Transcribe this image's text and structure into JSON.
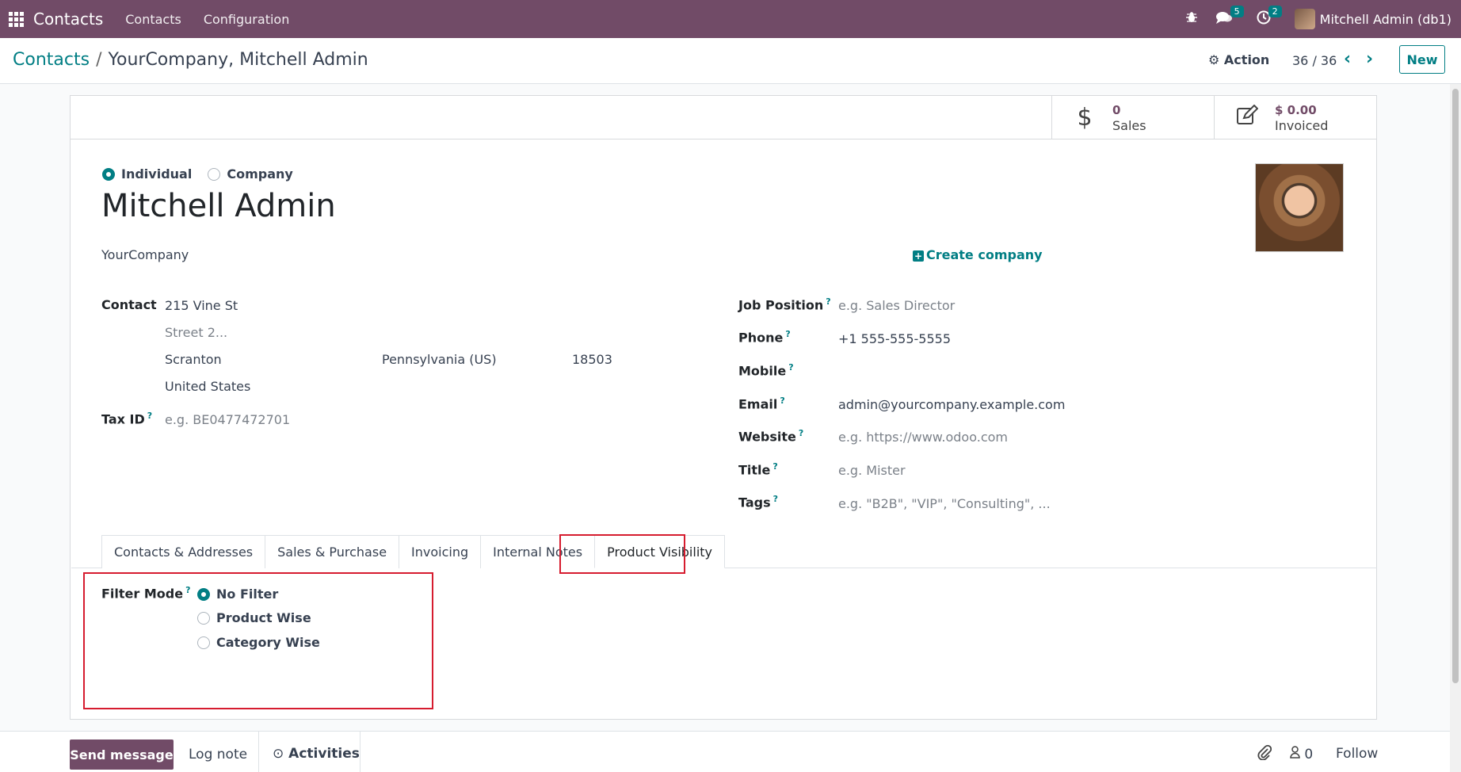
{
  "navbar": {
    "app_name": "Contacts",
    "menu": [
      "Contacts",
      "Configuration"
    ],
    "messages_badge": "5",
    "activities_badge": "2",
    "user": "Mitchell Admin (db1)",
    "icons": [
      "apps-grid-icon",
      "bug-icon",
      "chat-icon",
      "clock-icon",
      "avatar"
    ]
  },
  "breadcrumb": {
    "parent": "Contacts",
    "separator": "/",
    "current": "YourCompany, Mitchell Admin"
  },
  "controlpanel": {
    "action_label": "Action",
    "pager": "36 / 36",
    "new_label": "New"
  },
  "stat_buttons": [
    {
      "value": "0",
      "label": "Sales",
      "icon": "dollar-icon"
    },
    {
      "value": "$ 0.00",
      "label": "Invoiced",
      "icon": "edit-icon"
    }
  ],
  "partner": {
    "type_options": [
      "Individual",
      "Company"
    ],
    "selected_type": "Individual",
    "name": "Mitchell Admin",
    "company": "YourCompany",
    "create_company_label": "Create company"
  },
  "left_fields": {
    "contact_label": "Contact",
    "street": "215 Vine St",
    "street2_placeholder": "Street 2...",
    "city": "Scranton",
    "state": "Pennsylvania (US)",
    "zip": "18503",
    "country": "United States",
    "tax_label": "Tax ID",
    "tax_placeholder": "e.g. BE0477472701",
    "help_mark": "?"
  },
  "right_fields": [
    {
      "label": "Job Position",
      "value": "",
      "placeholder": "e.g. Sales Director"
    },
    {
      "label": "Phone",
      "value": "+1 555-555-5555",
      "placeholder": ""
    },
    {
      "label": "Mobile",
      "value": "",
      "placeholder": ""
    },
    {
      "label": "Email",
      "value": "admin@yourcompany.example.com",
      "placeholder": ""
    },
    {
      "label": "Website",
      "value": "",
      "placeholder": "e.g. https://www.odoo.com"
    },
    {
      "label": "Title",
      "value": "",
      "placeholder": "e.g. Mister"
    },
    {
      "label": "Tags",
      "value": "",
      "placeholder": "e.g. \"B2B\", \"VIP\", \"Consulting\", ..."
    }
  ],
  "tabs": [
    "Contacts & Addresses",
    "Sales & Purchase",
    "Invoicing",
    "Internal Notes",
    "Product Visibility"
  ],
  "active_tab": "Product Visibility",
  "filter_mode": {
    "label": "Filter Mode",
    "options": [
      "No Filter",
      "Product Wise",
      "Category Wise"
    ],
    "selected": "No Filter"
  },
  "chatter": {
    "send_message": "Send message",
    "log_note": "Log note",
    "activities": "Activities",
    "followers_count": "0",
    "follow": "Follow"
  },
  "colors": {
    "navbar": "#714b67",
    "accent": "#017e84",
    "highlight": "#d61c2f"
  }
}
